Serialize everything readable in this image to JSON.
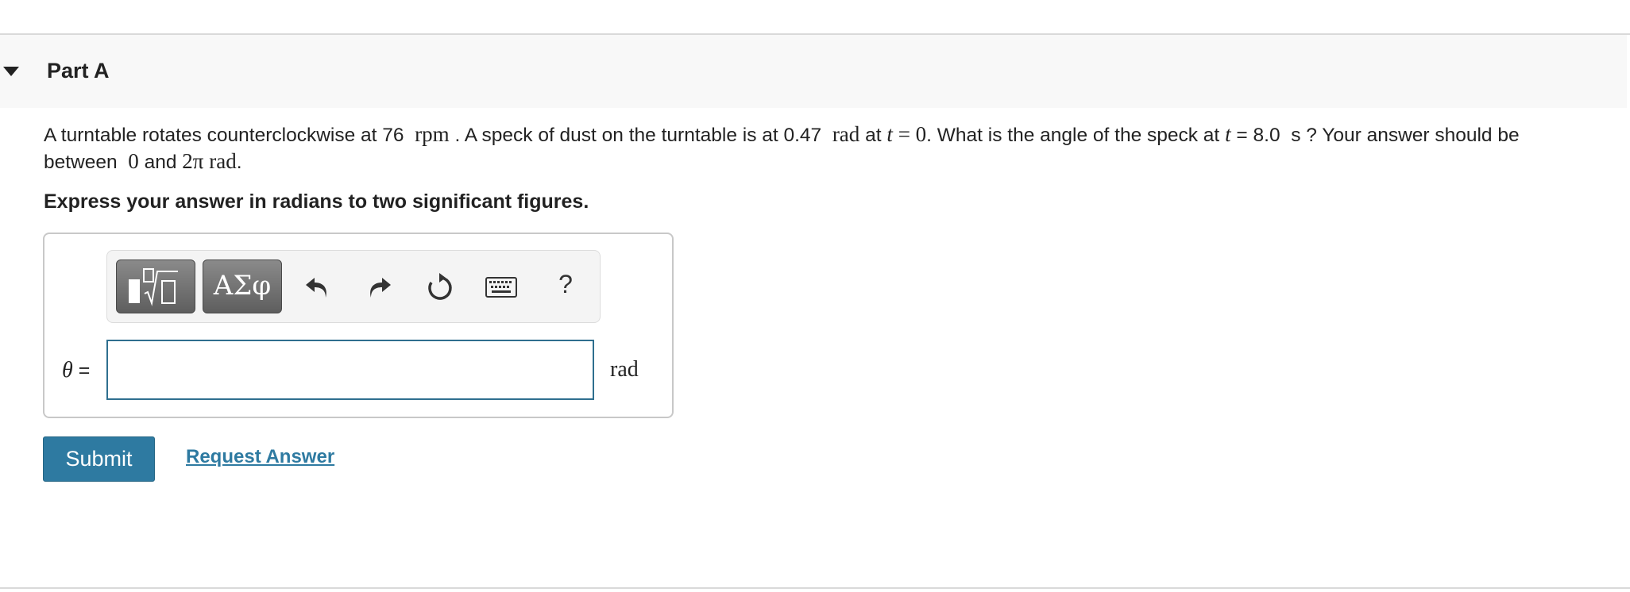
{
  "part": {
    "title": "Part A",
    "expanded": true
  },
  "question": {
    "intro": "A turntable rotates counterclockwise at 76",
    "rate_unit": "rpm",
    "sentence2_start": ". A speck of dust on the turntable is at 0.47",
    "angle_unit": "rad",
    "at_word": "at",
    "t_var": "t",
    "initial_eq": "= 0",
    "sentence3": ". What is the angle of the speck at",
    "t_var2": "t",
    "time_value": "= 8.0",
    "time_unit": "s",
    "sentence4": "? Your answer should be between",
    "range_low": "0",
    "and_word": "and",
    "range_high": "2π",
    "range_unit": "rad",
    "end_punct": "."
  },
  "instruction": "Express your answer in radians to two significant figures.",
  "toolbar": {
    "greek_label": "ΑΣφ",
    "help_label": "?",
    "icons": [
      "templates-icon",
      "greek-symbols-icon",
      "undo-icon",
      "redo-icon",
      "reset-icon",
      "keyboard-icon",
      "help-icon"
    ]
  },
  "answer": {
    "variable": "θ",
    "equals": "=",
    "value": "",
    "unit": "rad"
  },
  "actions": {
    "submit_label": "Submit",
    "request_label": "Request Answer"
  },
  "colors": {
    "accent": "#2e7aa1",
    "input_border": "#2f6f8f",
    "header_bg": "#f8f8f8"
  }
}
